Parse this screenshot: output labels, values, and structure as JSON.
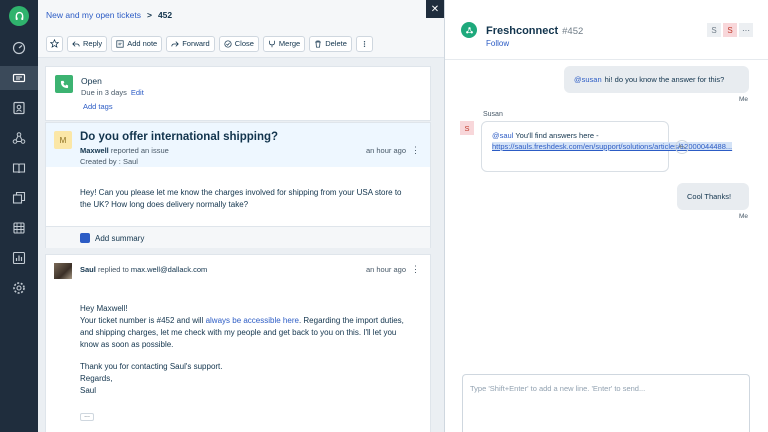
{
  "breadcrumb": {
    "view": "New and my open tickets",
    "separator": ">",
    "ticket_number": "452"
  },
  "toolbar": {
    "reply": "Reply",
    "add_note": "Add note",
    "forward": "Forward",
    "close": "Close",
    "merge": "Merge",
    "delete": "Delete"
  },
  "status": {
    "state": "Open",
    "due": "Due in 3 days",
    "edit": "Edit",
    "add_tags": "Add tags"
  },
  "issue": {
    "avatar_letter": "M",
    "title": "Do you offer international shipping?",
    "reporter": "Maxwell",
    "reported_text": "reported an issue",
    "created_by": "Created by : Saul",
    "time": "an hour ago",
    "body": "Hey! Can you please let me know the charges involved for shipping from your USA store to the UK? How long does delivery normally take?",
    "add_summary": "Add summary"
  },
  "reply": {
    "author": "Saul",
    "action": "replied to",
    "recipient": "max.well@dallack.com",
    "time": "an hour ago",
    "greeting": "Hey Maxwell!",
    "body_part1": "Your ticket number is #452 and will ",
    "body_link": "always be accessible here",
    "body_part2": ". Regarding the import duties, and shipping charges, let me check with my people and get back to you on this. I'll let you know as soon as possible.",
    "thanks": "Thank you for contacting Saul's support.",
    "regards": "Regards,",
    "signature": "Saul",
    "more": "..."
  },
  "chat": {
    "app_name": "Freshconnect",
    "ticket_ref": "#452",
    "follow": "Follow",
    "participants": [
      "S",
      "S"
    ],
    "more": "···",
    "messages": [
      {
        "mention": "@susan",
        "text": "hi! do you know the answer for this?",
        "sender": "Me"
      },
      {
        "sender": "Susan",
        "avatar": "S",
        "mention": "@saul",
        "text": "You'll find answers here -",
        "url": "https://sauls.freshdesk.com/en/support/solutions/articles/12000044488..."
      },
      {
        "text": "Cool Thanks!",
        "sender": "Me"
      }
    ],
    "composer_placeholder": "Type 'Shift+Enter' to add a new line. 'Enter' to send..."
  },
  "colors": {
    "rail": "#1f2d3d",
    "brand_green": "#2fb36d",
    "link": "#2c5cc5",
    "issue_header": "#eef7ff"
  }
}
